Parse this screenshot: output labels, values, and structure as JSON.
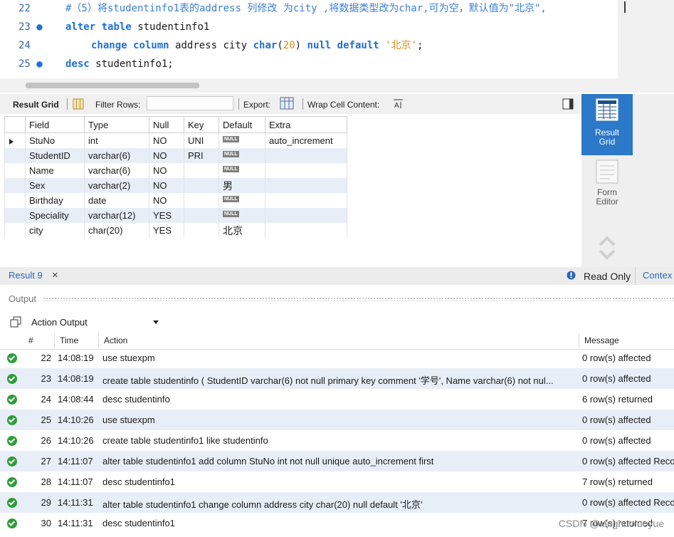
{
  "editor": {
    "lines": [
      {
        "num": "22",
        "dot": false,
        "comment": "#（5）将studentinfo1表的address 列修改 为city ,将数据类型改为char,可为空，默认值为\"北京\","
      },
      {
        "num": "23",
        "dot": true,
        "kw1": "alter",
        "kw2": "table",
        "ident": "studentinfo1"
      },
      {
        "num": "24",
        "dot": false,
        "kw1": "change",
        "kw2": "column",
        "ident": "address city",
        "type": "char",
        "lp": "(",
        "size": "20",
        "rp": ")",
        "kw3": "null",
        "kw4": "default",
        "str": "'北京'",
        "end": ";"
      },
      {
        "num": "25",
        "dot": true,
        "kw1": "desc",
        "ident": "studentinfo1;"
      }
    ]
  },
  "result_toolbar": {
    "result_grid": "Result Grid",
    "filter_rows": "Filter Rows:",
    "export": "Export:",
    "wrap": "Wrap Cell Content:"
  },
  "grid": {
    "columns": [
      "Field",
      "Type",
      "Null",
      "Key",
      "Default",
      "Extra"
    ],
    "null_label": "NULL",
    "rows": [
      {
        "field": "StuNo",
        "type": "int",
        "null": "NO",
        "key": "UNI",
        "default": null,
        "extra": "auto_increment"
      },
      {
        "field": "StudentID",
        "type": "varchar(6)",
        "null": "NO",
        "key": "PRI",
        "default": null,
        "extra": ""
      },
      {
        "field": "Name",
        "type": "varchar(6)",
        "null": "NO",
        "key": "",
        "default": null,
        "extra": ""
      },
      {
        "field": "Sex",
        "type": "varchar(2)",
        "null": "NO",
        "key": "",
        "default": "男",
        "extra": ""
      },
      {
        "field": "Birthday",
        "type": "date",
        "null": "NO",
        "key": "",
        "default": null,
        "extra": ""
      },
      {
        "field": "Speciality",
        "type": "varchar(12)",
        "null": "YES",
        "key": "",
        "default": null,
        "extra": ""
      },
      {
        "field": "city",
        "type": "char(20)",
        "null": "YES",
        "key": "",
        "default": "北京",
        "extra": ""
      }
    ]
  },
  "right_panel": {
    "result_grid": [
      "Result",
      "Grid"
    ],
    "form_editor": [
      "Form",
      "Editor"
    ]
  },
  "tabs": {
    "result": "Result 9",
    "close": "×",
    "read_only": "Read Only",
    "context": "Contex"
  },
  "output": {
    "title": "Output",
    "selector": "Action Output",
    "headers": {
      "num": "#",
      "time": "Time",
      "action": "Action",
      "message": "Message"
    },
    "rows": [
      {
        "num": "22",
        "time": "14:08:19",
        "action": "use stuexpm",
        "message": "0 row(s) affected"
      },
      {
        "num": "23",
        "time": "14:08:19",
        "action": "create table studentinfo ( StudentID varchar(6) not null primary key comment '学号',    Name varchar(6) not nul...",
        "message": "0 row(s) affected"
      },
      {
        "num": "24",
        "time": "14:08:44",
        "action": "desc studentinfo",
        "message": "6 row(s) returned"
      },
      {
        "num": "25",
        "time": "14:10:26",
        "action": "use stuexpm",
        "message": "0 row(s) affected"
      },
      {
        "num": "26",
        "time": "14:10:26",
        "action": "create table studentinfo1 like studentinfo",
        "message": "0 row(s) affected"
      },
      {
        "num": "27",
        "time": "14:11:07",
        "action": "alter table studentinfo1 add column StuNo int not null unique auto_increment first",
        "message": "0 row(s) affected Reco"
      },
      {
        "num": "28",
        "time": "14:11:07",
        "action": "desc studentinfo1",
        "message": "7 row(s) returned"
      },
      {
        "num": "29",
        "time": "14:11:31",
        "action": "alter table studentinfo1 change column address city char(20) null default '北京'",
        "message": "0 row(s) affected Reco"
      },
      {
        "num": "30",
        "time": "14:11:31",
        "action": "desc studentinfo1",
        "message": "7 row(s) returned"
      }
    ]
  },
  "watermark": "CSDN @xinghuoluoyue"
}
